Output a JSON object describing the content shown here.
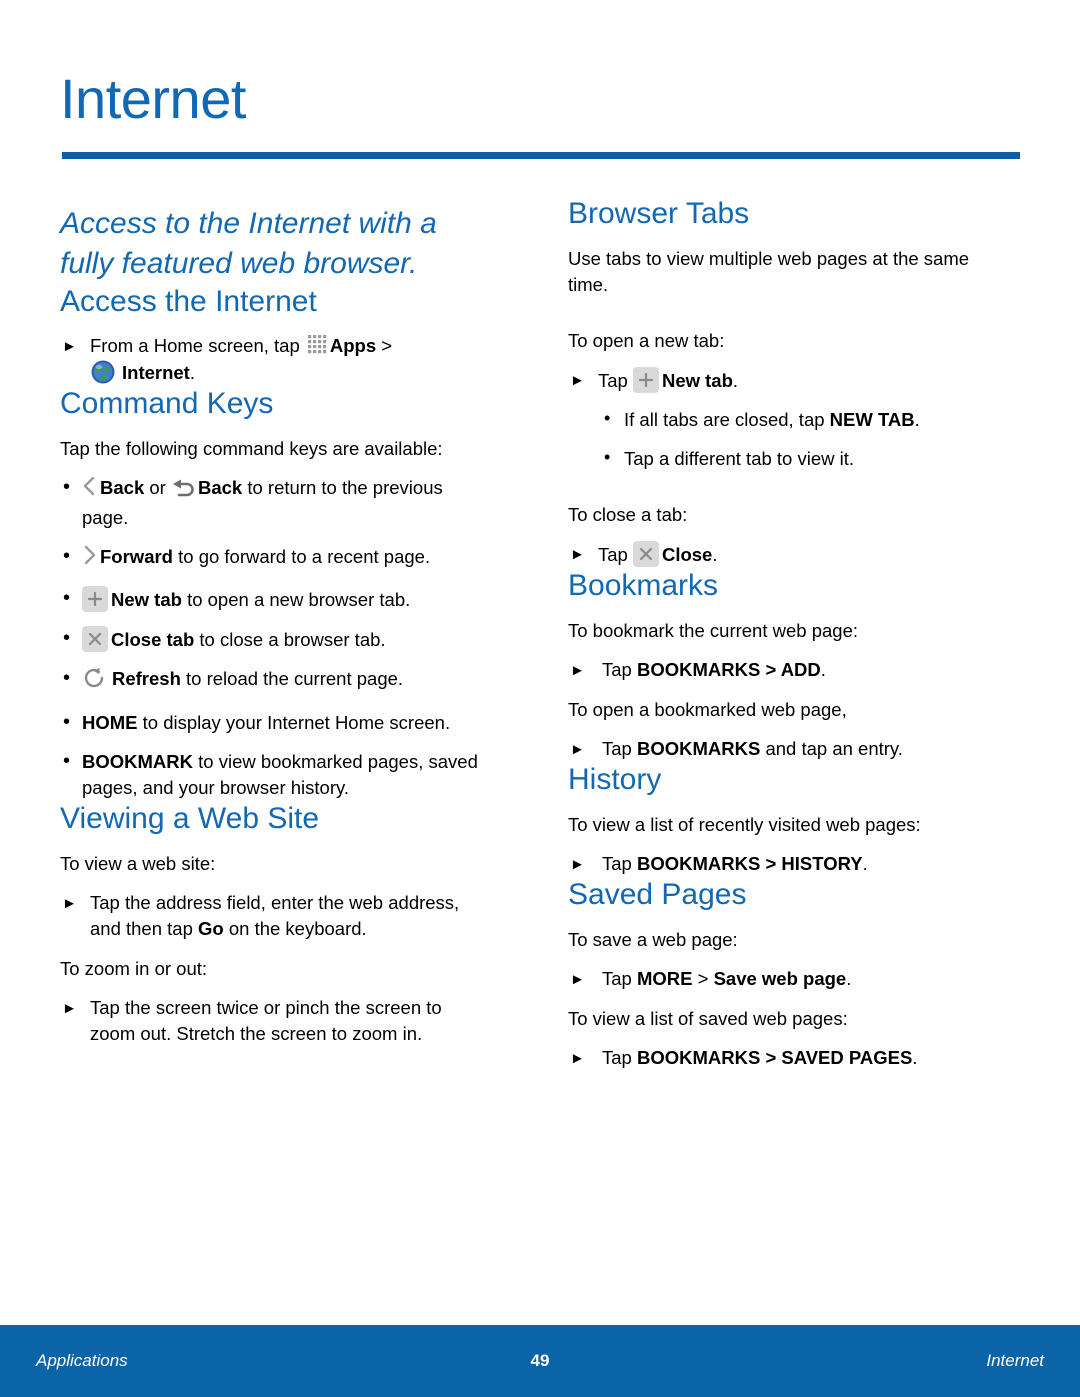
{
  "page": {
    "title": "Internet",
    "accent_blue": "#1268b3",
    "rule_blue": "#0b5ea8",
    "footer_blue": "#0b63a8"
  },
  "lede": "Access to the Internet with a fully featured web browser.",
  "left_column": {
    "access": {
      "heading": "Access the Internet",
      "step_pre": "From a Home screen, tap",
      "apps_label": "Apps",
      "chevron": ">",
      "internet_label": "Internet",
      "period": "."
    },
    "command_keys": {
      "heading": "Command Keys",
      "intro": "Tap the following command keys are available:",
      "items": [
        {
          "icon": "chevron-left-icon",
          "bold1": "Back",
          "mid": " or ",
          "icon2": "undo-arrow-icon",
          "bold2": "Back",
          "tail": " to return to the previous page."
        },
        {
          "icon": "chevron-right-icon",
          "bold1": "Forward",
          "tail": " to go forward to a recent page."
        },
        {
          "icon": "plus-key-icon",
          "bold1": "New tab",
          "tail": " to open a new browser tab."
        },
        {
          "icon": "close-key-icon",
          "bold1": "Close tab",
          "tail": " to close a browser tab."
        },
        {
          "icon": "refresh-icon",
          "bold1": "Refresh",
          "tail": " to reload the current page."
        },
        {
          "icon": "none",
          "bold1": "HOME",
          "tail": " to display your Internet Home screen."
        },
        {
          "icon": "none",
          "bold1": "BOOKMARK",
          "tail": " to view bookmarked pages, saved pages, and your browser history."
        }
      ]
    },
    "viewing": {
      "heading": "Viewing a Web Site",
      "lead1": "To view a web site:",
      "step1_pre": "Tap the address field, enter the web address, and then tap ",
      "step1_bold": "Go",
      "step1_post": " on the keyboard.",
      "lead2": "To zoom in or out:",
      "step2": "Tap the screen twice or pinch the screen to zoom out. Stretch the screen to zoom in."
    }
  },
  "right_column": {
    "browser_tabs": {
      "heading": "Browser Tabs",
      "intro": "Use tabs to view multiple web pages at the same time.",
      "lead_open": "To open a new tab:",
      "step_open_pre": "Tap",
      "step_open_bold": "New tab",
      "step_open_post": ".",
      "sub_items": [
        {
          "pre": "If all tabs are closed, tap ",
          "bold": "NEW TAB",
          "post": "."
        },
        {
          "pre": "Tap a different tab to view it.",
          "bold": "",
          "post": ""
        }
      ],
      "lead_close": "To close a tab:",
      "step_close_pre": "Tap",
      "step_close_bold": "Close",
      "step_close_post": "."
    },
    "bookmarks": {
      "heading": "Bookmarks",
      "lead1": "To bookmark the current web page:",
      "step1_pre": "Tap ",
      "step1_bold": "BOOKMARKS > ADD",
      "step1_post": ".",
      "lead2": "To open a bookmarked web page,",
      "step2_pre": "Tap ",
      "step2_bold": "BOOKMARKS",
      "step2_post": " and tap an entry."
    },
    "history": {
      "heading": "History",
      "lead1": "To view a list of recently visited web pages:",
      "step1_pre": "Tap ",
      "step1_bold": "BOOKMARKS > HISTORY",
      "step1_post": "."
    },
    "saved_pages": {
      "heading": "Saved Pages",
      "lead1": "To save a web page:",
      "step1_pre": "Tap ",
      "step1_boldA": "MORE",
      "step1_mid": " > ",
      "step1_boldB": "Save web page",
      "step1_post": ".",
      "lead2": "To view a list of saved web pages:",
      "step2_pre": "Tap ",
      "step2_bold": "BOOKMARKS > SAVED PAGES",
      "step2_post": "."
    }
  },
  "footer": {
    "left": "Applications",
    "page_number": "49",
    "right": "Internet"
  }
}
